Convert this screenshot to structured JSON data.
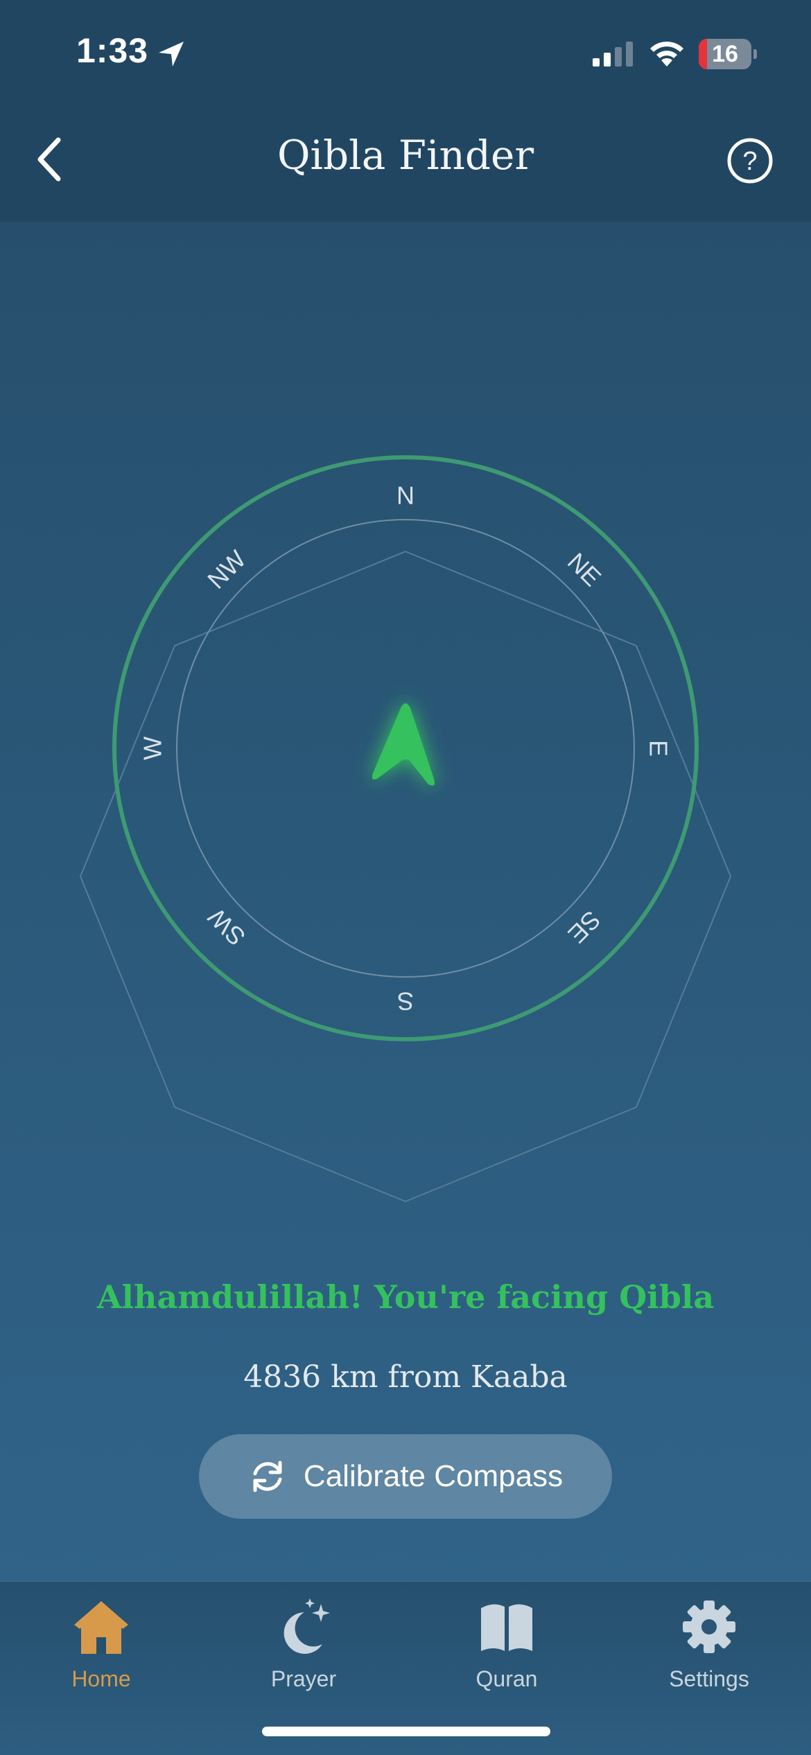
{
  "status_bar": {
    "time": "1:33",
    "battery": "16",
    "battery_level_percent": 16
  },
  "header": {
    "title": "Qibla Finder",
    "back_icon": "chevron-left-icon",
    "help_icon": "question-circle-icon"
  },
  "compass": {
    "directions": [
      "N",
      "NE",
      "E",
      "SE",
      "S",
      "SW",
      "W",
      "NW"
    ],
    "pointer_icon": "qibla-arrow-icon",
    "accent_color": "#35c15d"
  },
  "status_message": "Alhamdulillah! You're facing Qibla",
  "distance_text": "4836 km from Kaaba",
  "calibrate_button": {
    "label": "Calibrate Compass",
    "icon": "refresh-icon"
  },
  "tabs": [
    {
      "label": "Home",
      "icon": "home-icon",
      "active": true
    },
    {
      "label": "Prayer",
      "icon": "moon-stars-icon",
      "active": false
    },
    {
      "label": "Quran",
      "icon": "book-open-icon",
      "active": false
    },
    {
      "label": "Settings",
      "icon": "gear-icon",
      "active": false
    }
  ],
  "colors": {
    "active_tab": "#d79a4b",
    "success": "#35c15d"
  }
}
